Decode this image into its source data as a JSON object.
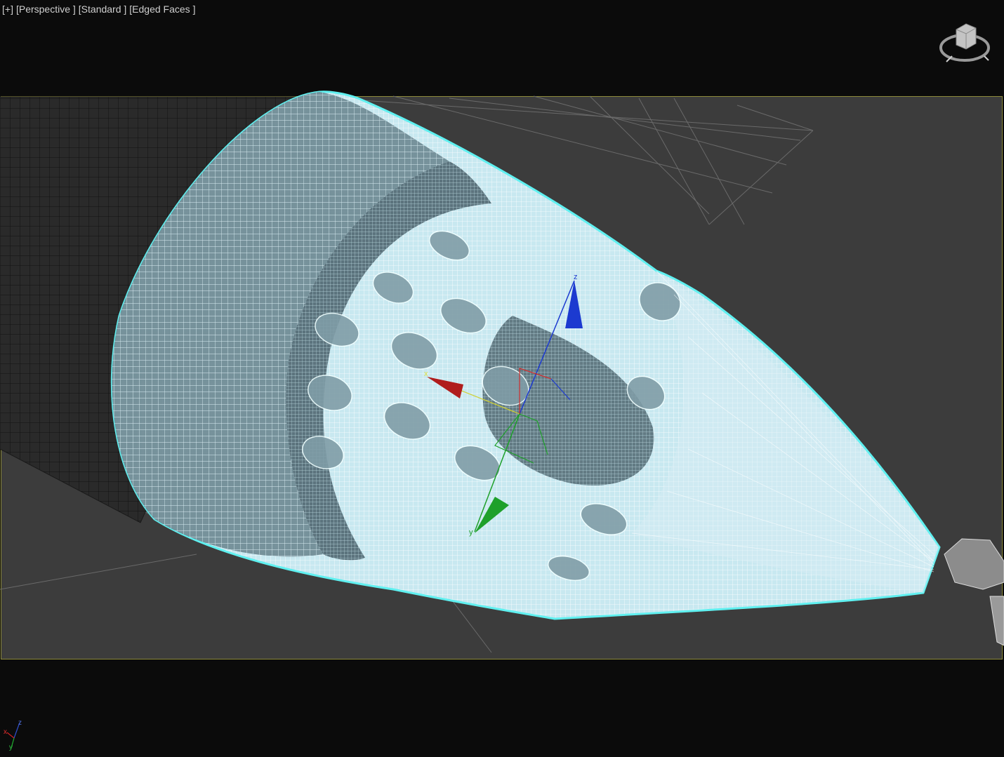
{
  "viewport": {
    "labels": [
      {
        "id": "plus",
        "text": "[+]"
      },
      {
        "id": "view",
        "text": "[Perspective ]"
      },
      {
        "id": "shading",
        "text": "[Standard ]"
      },
      {
        "id": "edged",
        "text": "[Edged Faces ]"
      }
    ]
  },
  "gizmo": {
    "x_label": "x",
    "y_label": "y",
    "z_label": "z",
    "x_color": "#b01c1c",
    "y_color": "#1ea02a",
    "z_color": "#1c3ad0"
  },
  "selection_color": "#5ff0f0",
  "safe_frame_color": "#8c8a3a",
  "tripod": {
    "x": "x",
    "y": "y",
    "z": "z"
  }
}
